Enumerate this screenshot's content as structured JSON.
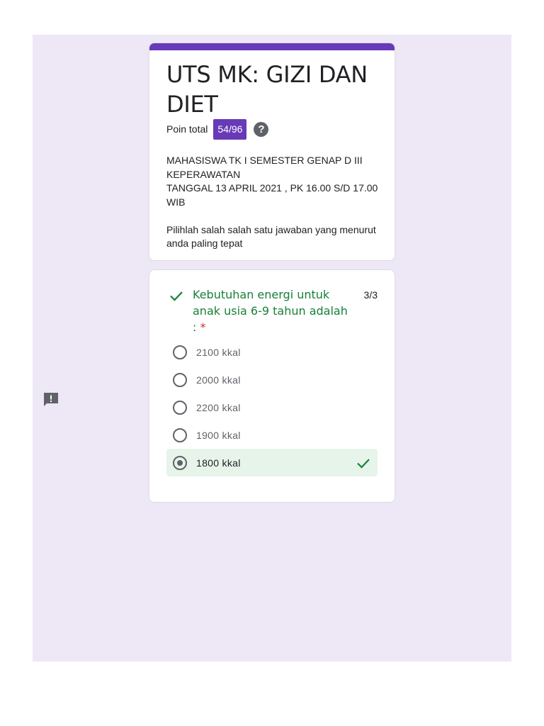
{
  "form": {
    "title": "UTS MK: GIZI DAN DIET",
    "points_label": "Poin total",
    "points_value": "54/96",
    "help_icon": "?",
    "description": "MAHASISWA TK I SEMESTER  GENAP D III KEPERAWATAN\nTANGGAL 13 APRIL 2021 , PK 16.00 S/D 17.00 WIB\n\nPilihlah salah salah satu jawaban yang menurut anda paling tepat"
  },
  "question": {
    "title": "Kebutuhan energi untuk anak usia 6-9 tahun adalah :",
    "required_mark": "*",
    "score": "3/3",
    "options": [
      {
        "label": "2100 kkal",
        "selected": false
      },
      {
        "label": "2000 kkal",
        "selected": false
      },
      {
        "label": "2200 kkal",
        "selected": false
      },
      {
        "label": "1900 kkal",
        "selected": false
      },
      {
        "label": "1800 kkal",
        "selected": true
      }
    ]
  },
  "icons": {
    "question_status": "check-icon",
    "correct_answer": "check-icon",
    "side_feedback": "feedback-icon"
  },
  "colors": {
    "accent": "#673ab7",
    "background": "#ede7f6",
    "correct_green": "#188038",
    "correct_bg": "#e6f4ea",
    "required_red": "#d93025"
  }
}
